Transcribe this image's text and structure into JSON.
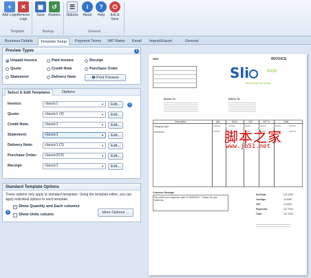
{
  "ribbon": {
    "template_group": {
      "label": "Template",
      "buttons": [
        {
          "label": "Add Logo",
          "icon": "add-logo-icon"
        },
        {
          "label": "Remove Logo",
          "icon": "remove-logo-icon"
        }
      ]
    },
    "backup_group": {
      "label": "Backup",
      "buttons": [
        {
          "label": "Save",
          "icon": "save-icon"
        },
        {
          "label": "Restore",
          "icon": "restore-icon"
        }
      ]
    },
    "general_group": {
      "label": "General",
      "buttons": [
        {
          "label": "Options",
          "icon": "options-icon"
        },
        {
          "label": "About",
          "icon": "about-icon"
        },
        {
          "label": "Help",
          "icon": "help-icon"
        },
        {
          "label": "Exit & Save",
          "icon": "exit-icon"
        }
      ]
    }
  },
  "tabs": [
    "Business Details",
    "Template Setup",
    "Payment Terms",
    "VAT Rates",
    "Email",
    "Import/Export",
    "General"
  ],
  "active_tab": "Template Setup",
  "preview_types": {
    "title": "Preview Types",
    "options": [
      "Unpaid Invoice",
      "Paid Invoice",
      "Receipt",
      "Quote",
      "Credit Note",
      "Purchase Order",
      "Statement",
      "Delivery Note"
    ],
    "selected": "Unpaid Invoice",
    "print_button": "Print Preview"
  },
  "templates": {
    "tabs": [
      "Select & Edit Templates",
      "Options"
    ],
    "rows": [
      {
        "label": "Invoice:",
        "value": "classic1",
        "edit": "Edit..."
      },
      {
        "label": "Quote:",
        "value": "classic1 (4)",
        "edit": "Edit..."
      },
      {
        "label": "Credit Note:",
        "value": "classic1",
        "edit": "Edit..."
      },
      {
        "label": "Statement:",
        "value": "classic1",
        "edit": "Edit..."
      },
      {
        "label": "Delivery Note:",
        "value": "classic1 (3)",
        "edit": "Edit..."
      },
      {
        "label": "Purchase Order:",
        "value": "classic2011",
        "edit": "Edit..."
      },
      {
        "label": "Receipt:",
        "value": "classic1",
        "edit": "Edit..."
      }
    ]
  },
  "standard_options": {
    "title": "Standard Template Options",
    "description": "These options only apply to standard templates. Using the template editor, you can apply individual options to each template.",
    "checkbox1": "Show Quantity and Each  columns",
    "checkbox1_checked": true,
    "checkbox2": "Show Units column",
    "checkbox2_checked": false,
    "more_button": "More Options ..."
  },
  "preview": {
    "company": "test",
    "doc_title": "INVOICE",
    "logo_text": "Sli",
    "logo_sub": "tools",
    "logo_tagline": "easy invoicing and quoting",
    "invoice_to": "Invoice To:",
    "deliver_to": "Deliver To:",
    "columns": [
      "Description",
      "Qty",
      "Each",
      "VAT",
      "VAT %",
      "Total"
    ],
    "items": [
      "Hanging Light",
      "Electronic"
    ],
    "customer_message_label": "Customer Message",
    "customer_message": "Pay within your days/due date of 30/09/2007. Thanks for your business.",
    "totals": [
      {
        "label": "SubTotal:",
        "value": "101.2000"
      },
      {
        "label": "Carriage:",
        "value": "10.0000"
      },
      {
        "label": "VAT:",
        "value": "14.5400"
      },
      {
        "label": "Payments:",
        "value": "112.7000"
      },
      {
        "label": "Total:",
        "value": "112.7000"
      }
    ]
  },
  "watermark": {
    "main": "脚本之家",
    "sub": "www.jb51.net"
  },
  "colors": {
    "accent": "#2f74c8",
    "ribbon": "#dfe9f5",
    "logo": "#1e5aa8",
    "logo_green": "#8cc63f",
    "watermark": "#d40000"
  }
}
